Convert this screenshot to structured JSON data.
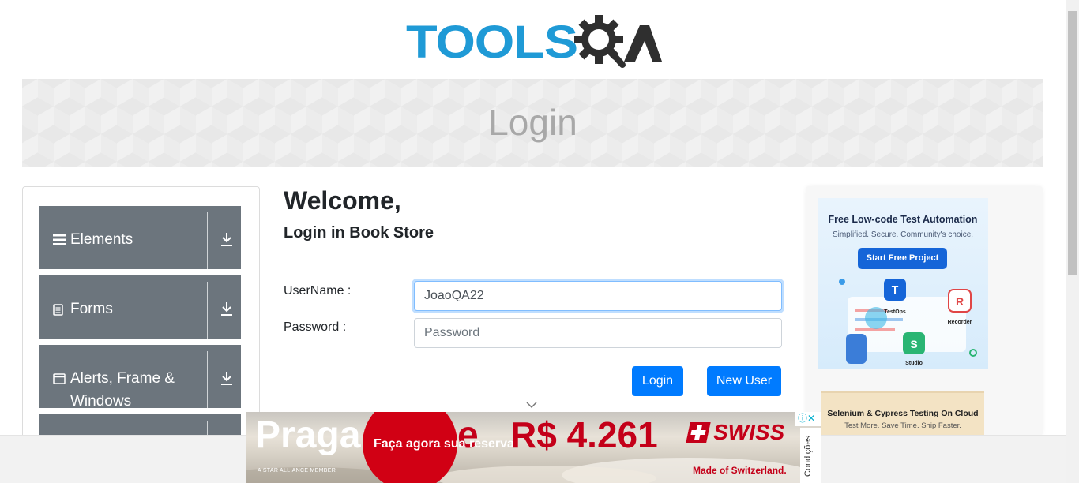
{
  "header": {
    "logo_text": "TOOLSQA",
    "logo_text_part": "TOOLS"
  },
  "banner": {
    "title": "Login"
  },
  "sidebar": {
    "groups": [
      {
        "label": "Elements",
        "icon": "hamburger-icon"
      },
      {
        "label": "Forms",
        "icon": "document-icon"
      },
      {
        "label": "Alerts, Frame & Windows",
        "icon": "window-icon"
      }
    ]
  },
  "main": {
    "welcome": "Welcome,",
    "subtitle": "Login in Book Store",
    "username_label": "UserName :",
    "username_value": "JoaoQA22",
    "password_label": "Password :",
    "password_placeholder": "Password",
    "login_button": "Login",
    "new_user_button": "New User"
  },
  "ads": {
    "side_ad": {
      "headline": "Free Low-code Test Automation",
      "subline": "Simplified. Secure. Community's choice.",
      "cta": "Start Free Project",
      "labels": [
        "TestOps",
        "Recorder",
        "Studio"
      ]
    },
    "side_ad2": {
      "headline": "Selenium & Cypress Testing On Cloud",
      "subline": "Test More. Save Time. Ship Faster."
    },
    "bottom_ad": {
      "city": "Praga",
      "e": "e",
      "offer": "Faça agora sua reserva",
      "price": "R$ 4.261",
      "brand": "SWISS",
      "tagline": "Made of Switzerland.",
      "alliance": "A STAR ALLIANCE MEMBER",
      "conditions": "Condições"
    }
  },
  "colors": {
    "primary": "#007bff",
    "sidebar": "#6c757d",
    "logo_blue": "#1f9ad6",
    "logo_dark": "#3a3a3a"
  }
}
